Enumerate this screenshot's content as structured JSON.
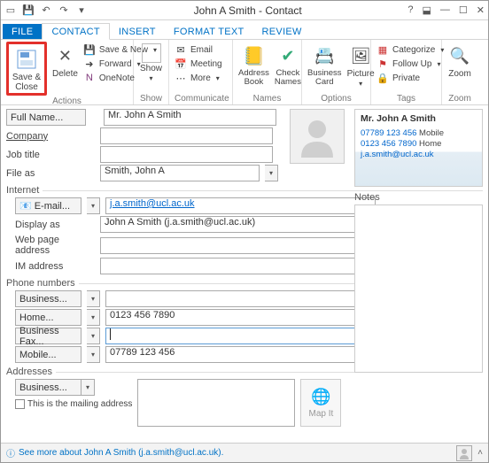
{
  "window": {
    "title": "John A Smith - Contact"
  },
  "tabs": {
    "file": "FILE",
    "contact": "CONTACT",
    "insert": "INSERT",
    "format": "FORMAT TEXT",
    "review": "REVIEW"
  },
  "ribbon": {
    "actions": {
      "label": "Actions",
      "save_close": "Save & Close",
      "delete": "Delete",
      "save_new": "Save & New",
      "forward": "Forward",
      "onenote": "OneNote"
    },
    "show": {
      "label": "Show",
      "show": "Show"
    },
    "communicate": {
      "label": "Communicate",
      "email": "Email",
      "meeting": "Meeting",
      "more": "More"
    },
    "names": {
      "label": "Names",
      "address_book": "Address Book",
      "check_names": "Check Names"
    },
    "options": {
      "label": "Options",
      "business_card": "Business Card",
      "picture": "Picture"
    },
    "tags": {
      "label": "Tags",
      "categorize": "Categorize",
      "followup": "Follow Up",
      "private": "Private"
    },
    "zoom": {
      "label": "Zoom",
      "zoom": "Zoom"
    }
  },
  "form": {
    "full_name_btn": "Full Name...",
    "full_name_val": "Mr. John A Smith",
    "company_lbl": "Company",
    "company_val": "",
    "jobtitle_lbl": "Job title",
    "jobtitle_val": "",
    "fileas_lbl": "File as",
    "fileas_val": "Smith, John A",
    "internet_hdr": "Internet",
    "email_btn": "E-mail...",
    "email_val": "j.a.smith@ucl.ac.uk",
    "display_lbl": "Display as",
    "display_val": "John A Smith (j.a.smith@ucl.ac.uk)",
    "web_lbl": "Web page address",
    "web_val": "",
    "im_lbl": "IM address",
    "im_val": "",
    "phones_hdr": "Phone numbers",
    "ph_business_btn": "Business...",
    "ph_business_val": "",
    "ph_home_btn": "Home...",
    "ph_home_val": "0123 456 7890",
    "ph_bfax_btn": "Business Fax...",
    "ph_bfax_val": "",
    "ph_mobile_btn": "Mobile...",
    "ph_mobile_val": "07789 123 456",
    "addr_hdr": "Addresses",
    "addr_business_btn": "Business...",
    "addr_mailing_lbl": "This is the mailing address",
    "mapit": "Map It",
    "notes_hdr": "Notes"
  },
  "bcard": {
    "name": "Mr. John A Smith",
    "mobile_num": "07789 123 456",
    "mobile_lbl": "Mobile",
    "home_num": "0123 456 7890",
    "home_lbl": "Home",
    "email": "j.a.smith@ucl.ac.uk"
  },
  "status": {
    "text": "See more about John A Smith (j.a.smith@ucl.ac.uk)."
  }
}
